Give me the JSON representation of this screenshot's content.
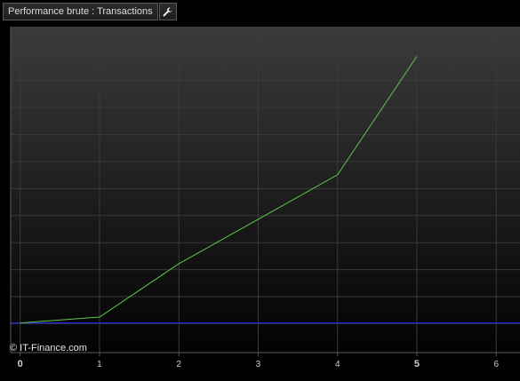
{
  "header": {
    "title": "Performance brute : Transactions",
    "tool_icon": "wrench-icon"
  },
  "copyright": "© IT-Finance.com",
  "colors": {
    "series_line": "#5cc94a",
    "baseline": "#2a2aff",
    "grid": "#3a3a3a",
    "plot_top": "#3b3b3b",
    "plot_bottom": "#020202"
  },
  "chart_data": {
    "type": "line",
    "title": "",
    "xlabel": "",
    "ylabel": "",
    "x_ticks": [
      "0",
      "1",
      "2",
      "3",
      "4",
      "5",
      "6"
    ],
    "bold_ticks": [
      "0",
      "5"
    ],
    "xlim": [
      -0.12,
      6.3
    ],
    "ylim": [
      -1,
      10
    ],
    "grid": true,
    "series": [
      {
        "x": [
          0,
          1,
          2,
          3,
          4,
          5
        ],
        "y": [
          0,
          0.2,
          2.0,
          3.5,
          5.0,
          9.0
        ]
      }
    ],
    "baseline_y": 0
  }
}
